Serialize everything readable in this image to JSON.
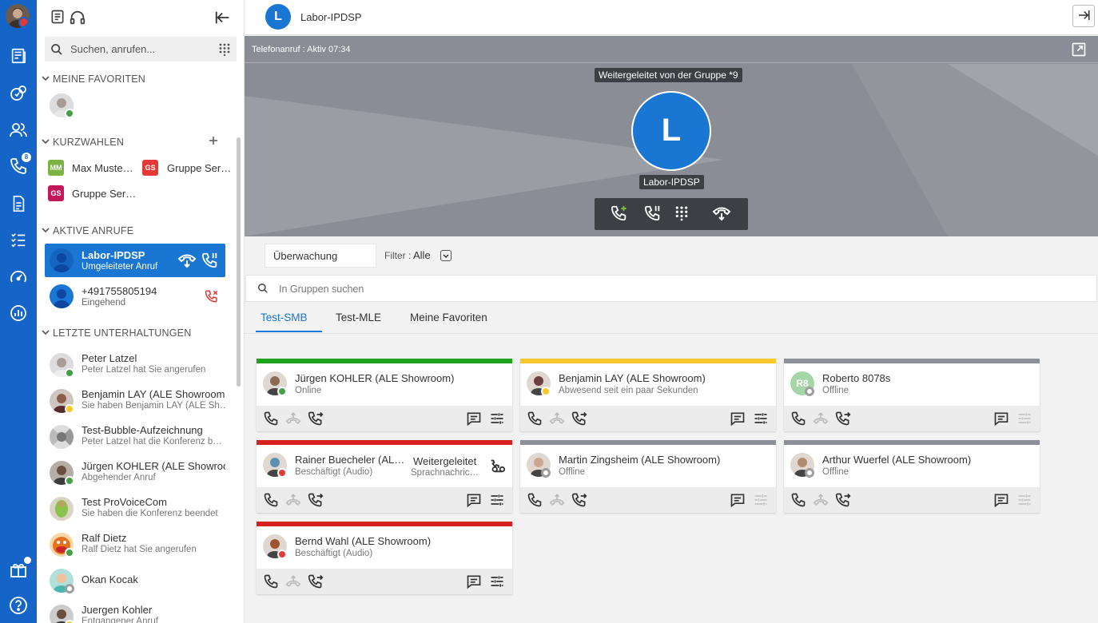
{
  "colors": {
    "primary": "#1976d2",
    "rail": "#1565c8",
    "online": "#43a047",
    "away": "#f9c82a",
    "busy": "#e53935",
    "offline": "#9e9e9e"
  },
  "sidebar": {
    "search_placeholder": "Suchen, anrufen...",
    "favorites_header": "MEINE FAVORITEN",
    "speed_dial_header": "KURZWAHLEN",
    "speed_dials": [
      {
        "initials": "MM",
        "label": "Max Muste…",
        "color": "#7cb342"
      },
      {
        "initials": "GS",
        "label": "Gruppe Ser…",
        "color": "#e53935"
      },
      {
        "initials": "GS",
        "label": "Gruppe Ser…",
        "color": "#c2185b"
      }
    ],
    "active_calls_header": "AKTIVE ANRUFE",
    "active_calls": [
      {
        "name": "Labor-IPDSP",
        "sub": "Umgeleiteter Anruf"
      },
      {
        "name": "+491755805194",
        "sub": "Eingehend"
      }
    ],
    "conversations_header": "LETZTE UNTERHALTUNGEN",
    "conversations": [
      {
        "name": "Peter Latzel",
        "sub": "Peter Latzel hat Sie angerufen"
      },
      {
        "name": "Benjamin LAY (ALE Showroom",
        "sub": "Sie haben Benjamin LAY (ALE Sh…"
      },
      {
        "name": "Test-Bubble-Aufzeichnung",
        "sub": "Peter Latzel hat die Konferenz b…"
      },
      {
        "name": "Jürgen KOHLER (ALE Showroor",
        "sub": "Abgehender Anruf"
      },
      {
        "name": "Test ProVoiceCom",
        "sub": "Sie haben die Konferenz beendet"
      },
      {
        "name": "Ralf Dietz",
        "sub": "Ralf Dietz hat Sie angerufen"
      },
      {
        "name": "Okan Kocak",
        "sub": ""
      },
      {
        "name": "Juergen Kohler",
        "sub": "Entgangener Anruf"
      }
    ],
    "rail_badge": "8"
  },
  "header": {
    "avatar_letter": "L",
    "title": "Labor-IPDSP"
  },
  "call": {
    "status": "Telefonanruf : Aktiv  07:34",
    "forwarded_text": "Weitergeleitet von der Gruppe *9",
    "avatar_letter": "L",
    "name": "Labor-IPDSP"
  },
  "filter": {
    "monitoring": "Überwachung",
    "filter_label": "Filter :",
    "filter_value": "Alle"
  },
  "group_search_placeholder": "In Gruppen suchen",
  "tabs": [
    {
      "label": "Test-SMB",
      "active": true
    },
    {
      "label": "Test-MLE",
      "active": false
    },
    {
      "label": "Meine Favoriten",
      "active": false
    }
  ],
  "cards": [
    {
      "name": "Jürgen KOHLER (ALE Showroom)",
      "sub": "Online",
      "bar": "#1ea31e",
      "status": "online"
    },
    {
      "name": "Benjamin LAY (ALE Showroom)",
      "sub": "Abwesend seit ein paar Sekunden",
      "bar": "#f9c82a",
      "status": "away"
    },
    {
      "name": "Roberto 8078s",
      "sub": "Offline",
      "bar": "#8e9099",
      "status": "offline",
      "initials": "R8"
    },
    {
      "name": "Rainer Buecheler (AL…",
      "sub": "Beschäftigt (Audio)",
      "bar": "#d61f1f",
      "status": "busy",
      "fwd": "Weitergeleitet",
      "fwd_sub": "Sprachnachric…"
    },
    {
      "name": "Martin Zingsheim (ALE Showroom)",
      "sub": "Offline",
      "bar": "#8e9099",
      "status": "offline"
    },
    {
      "name": "Arthur Wuerfel (ALE Showroom)",
      "sub": "Offline",
      "bar": "#8e9099",
      "status": "offline"
    },
    {
      "name": "Bernd Wahl (ALE Showroom)",
      "sub": "Beschäftigt (Audio)",
      "bar": "#d61f1f",
      "status": "busy"
    }
  ]
}
